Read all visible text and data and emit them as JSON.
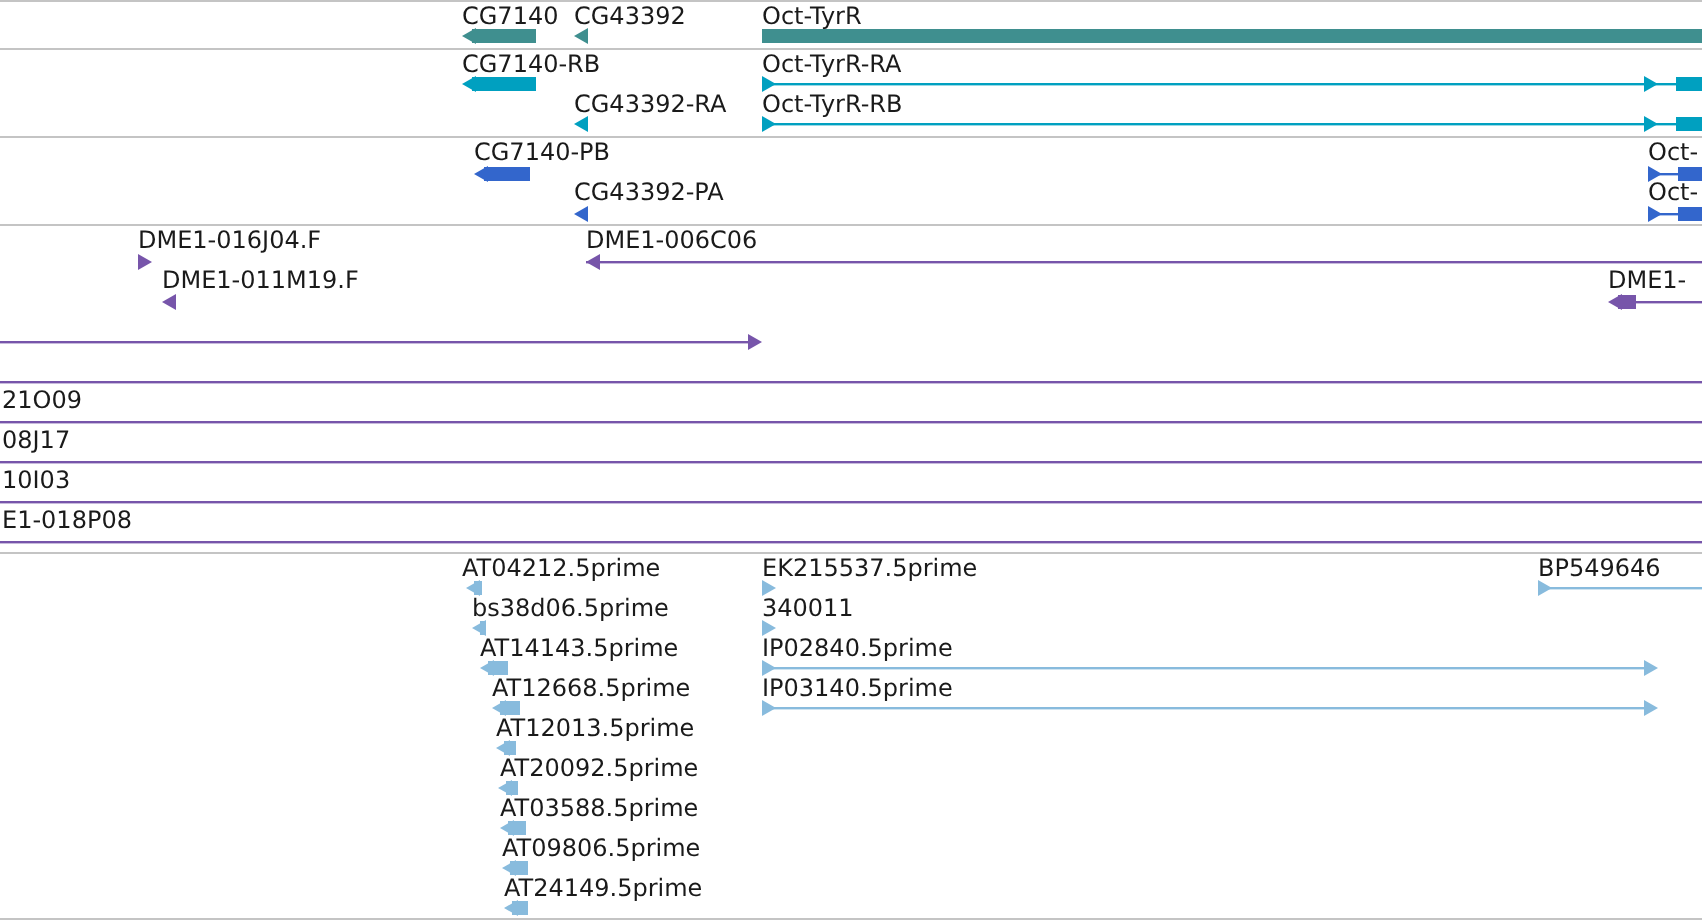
{
  "tracks": [
    {
      "color": "#3f8f8f",
      "features": [
        {
          "label": "CG7140",
          "kind": "arrow",
          "reverse": true
        },
        {
          "label": "CG43392",
          "kind": "arrow",
          "reverse": true
        },
        {
          "label": "Oct-TyrR",
          "kind": "block"
        }
      ]
    },
    {
      "color": "#00a0c0",
      "features": [
        {
          "label": "CG7140-RB",
          "kind": "arrow",
          "reverse": true
        },
        {
          "label": "Oct-TyrR-RA",
          "kind": "arrow",
          "reverse": false
        },
        {
          "label": "CG43392-RA",
          "kind": "arrow",
          "reverse": true
        },
        {
          "label": "Oct-TyrR-RB",
          "kind": "arrow",
          "reverse": false
        }
      ]
    },
    {
      "color": "#3366cc",
      "features": [
        {
          "label": "CG7140-PB",
          "kind": "arrow",
          "reverse": true
        },
        {
          "label": "Oct-",
          "kind": "arrow",
          "reverse": false
        },
        {
          "label": "CG43392-PA",
          "kind": "arrow",
          "reverse": true
        },
        {
          "label": "Oct-",
          "kind": "arrow",
          "reverse": false
        }
      ]
    },
    {
      "color": "#7755aa",
      "features": [
        {
          "label": "DME1-016J04.F",
          "kind": "arrow",
          "reverse": false
        },
        {
          "label": "DME1-006C06",
          "kind": "arrow",
          "reverse": true
        },
        {
          "label": "DME1-011M19.F",
          "kind": "arrow",
          "reverse": true
        },
        {
          "label": "DME1-",
          "kind": "arrow",
          "reverse": true
        },
        {
          "kind": "arrow",
          "reverse": false
        },
        {
          "kind": "line"
        },
        {
          "label": "21O09",
          "kind": "line"
        },
        {
          "label": "08J17",
          "kind": "line"
        },
        {
          "label": "10I03",
          "kind": "line"
        },
        {
          "label": "E1-018P08",
          "kind": "line"
        }
      ]
    },
    {
      "color": "#88bbdd",
      "features": [
        {
          "label": "AT04212.5prime",
          "kind": "arrow",
          "reverse": true
        },
        {
          "label": "EK215537.5prime",
          "kind": "arrow",
          "reverse": false
        },
        {
          "label": "BP549646",
          "kind": "arrow",
          "reverse": false
        },
        {
          "label": "bs38d06.5prime",
          "kind": "arrow",
          "reverse": true
        },
        {
          "label": "340011",
          "kind": "arrow",
          "reverse": false
        },
        {
          "label": "AT14143.5prime",
          "kind": "arrow",
          "reverse": true
        },
        {
          "label": "IP02840.5prime",
          "kind": "arrow",
          "reverse": false
        },
        {
          "label": "AT12668.5prime",
          "kind": "arrow",
          "reverse": true
        },
        {
          "label": "IP03140.5prime",
          "kind": "arrow",
          "reverse": false
        },
        {
          "label": "AT12013.5prime",
          "kind": "arrow",
          "reverse": true
        },
        {
          "label": "AT20092.5prime",
          "kind": "arrow",
          "reverse": true
        },
        {
          "label": "AT03588.5prime",
          "kind": "arrow",
          "reverse": true
        },
        {
          "label": "AT09806.5prime",
          "kind": "arrow",
          "reverse": true
        },
        {
          "label": "AT24149.5prime",
          "kind": "arrow",
          "reverse": true
        }
      ]
    }
  ]
}
